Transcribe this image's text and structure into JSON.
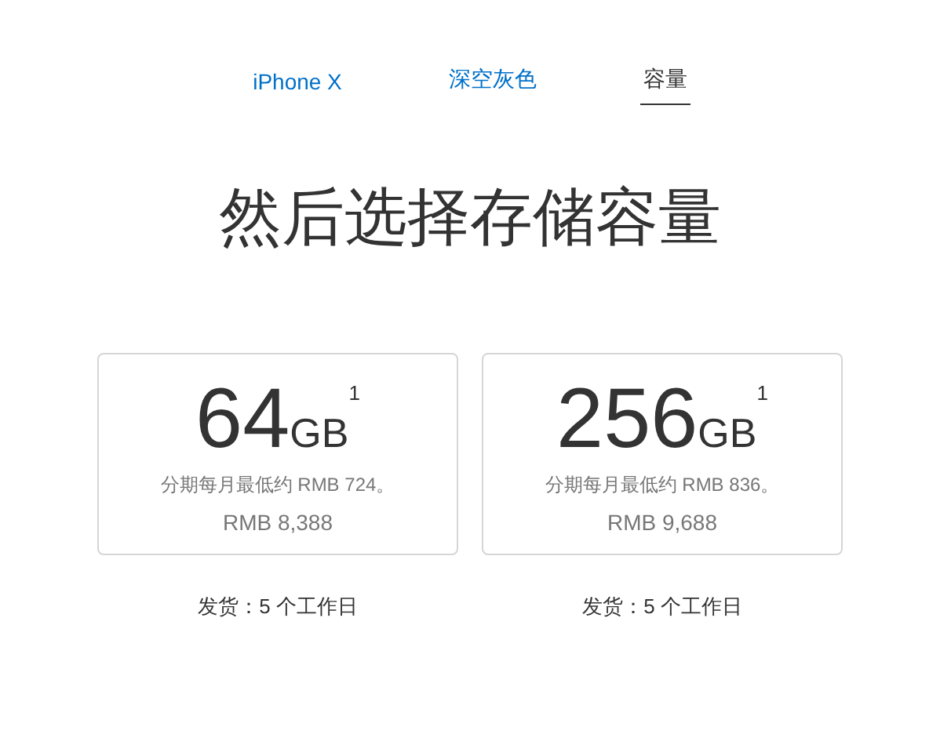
{
  "steps": [
    {
      "label": "iPhone X",
      "selected": false
    },
    {
      "label": "深空灰色",
      "selected": false
    },
    {
      "label": "容量",
      "selected": true
    }
  ],
  "heading": "然后选择存储容量",
  "options": [
    {
      "number": "64",
      "unit": "GB",
      "footnote": "1",
      "monthly": "分期每月最低约 RMB 724。",
      "price": "RMB 8,388",
      "shipping": "发货：5 个工作日"
    },
    {
      "number": "256",
      "unit": "GB",
      "footnote": "1",
      "monthly": "分期每月最低约 RMB 836。",
      "price": "RMB 9,688",
      "shipping": "发货：5 个工作日"
    }
  ]
}
